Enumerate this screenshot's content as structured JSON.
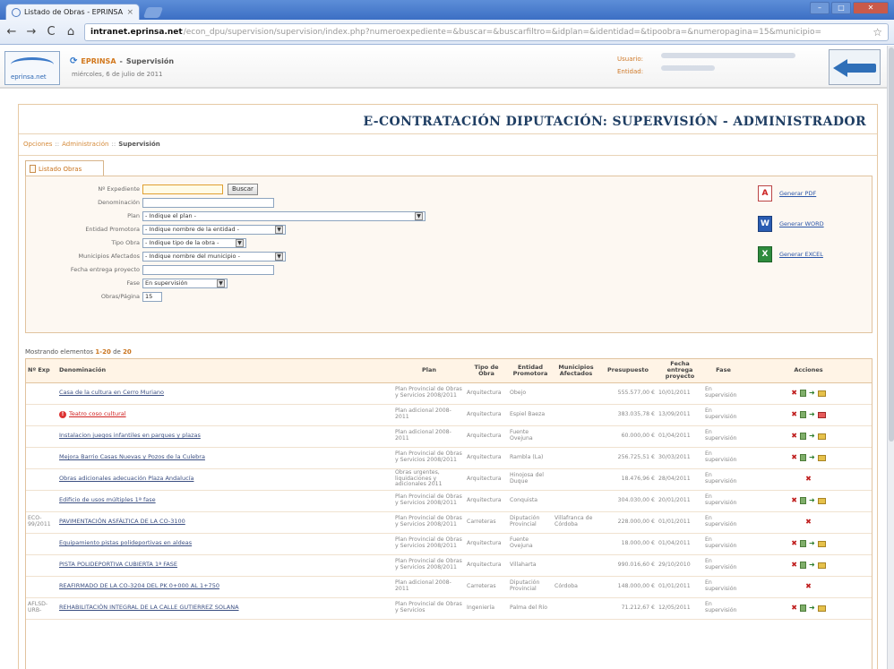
{
  "browser": {
    "tab_title": "Listado de Obras - EPRINSA",
    "tab_close": "×",
    "url_domain": "intranet.eprinsa.net",
    "url_path": "/econ_dpu/supervision/supervision/index.php?numeroexpediente=&buscar=&buscarfiltro=&idplan=&identidad=&tipoobra=&numeropagina=15&municipio=",
    "back": "←",
    "forward": "→",
    "reload": "C",
    "home": "⌂",
    "star": "☆",
    "win_min": "–",
    "win_max": "□",
    "win_close": "✕"
  },
  "header": {
    "org": "EPRINSA",
    "section": "Supervisión",
    "title_sep": "-",
    "date": "miércoles, 6 de julio de 2011",
    "user_label": "Usuario:",
    "entity_label": "Entidad:",
    "logo_text": "eprinsa.net"
  },
  "page_title": "E-CONTRATACIÓN DIPUTACIÓN: SUPERVISIÓN - ADMINISTRADOR",
  "breadcrumb": {
    "items": [
      "Opciones",
      "Administración",
      "Supervisión"
    ],
    "sep": "::"
  },
  "tab_label": "Listado Obras",
  "form": {
    "expediente_label": "Nº Expediente",
    "expediente_value": "",
    "search_button": "Buscar",
    "denominacion_label": "Denominación",
    "plan_label": "Plan",
    "plan_value": "- Indique el plan -",
    "entidad_label": "Entidad Promotora",
    "entidad_value": "- Indique nombre de la entidad -",
    "tipo_label": "Tipo Obra",
    "tipo_value": "- Indique tipo de la obra -",
    "municipio_label": "Municipios Afectados",
    "municipio_value": "- Indique nombre del municipio -",
    "fecha_label": "Fecha entrega proyecto",
    "fase_label": "Fase",
    "fase_value": "En supervisión",
    "obras_pagina_label": "Obras/Página",
    "obras_pagina_value": "15"
  },
  "exports": {
    "pdf": "Generar PDF",
    "word": "Generar WORD",
    "excel": "Generar EXCEL",
    "pdf_icon": "pdf-icon",
    "word_icon": "word-icon",
    "excel_icon": "excel-icon"
  },
  "showing": {
    "prefix": "Mostrando elementos",
    "range": "1-20",
    "de": "de",
    "total": "20"
  },
  "table": {
    "columns": [
      "Nº Exp",
      "Denominación",
      "Plan",
      "Tipo de Obra",
      "Entidad Promotora",
      "Municipios Afectados",
      "Presupuesto",
      "Fecha entrega proyecto",
      "Fase",
      "Acciones"
    ],
    "rows": [
      {
        "exp": "",
        "den": "Casa de la cultura en Cerro Muriano",
        "alert": false,
        "plan": "Plan Provincial de Obras y Servicios 2008/2011",
        "tipo": "Arquitectura",
        "entidad": "Obejo",
        "muni": "",
        "pres": "555.577,00 €",
        "fecha": "10/01/2011",
        "fase": "En supervisión",
        "actions": [
          "del",
          "doc",
          "arr",
          "fld"
        ]
      },
      {
        "exp": "",
        "den": "Teatro coso cultural",
        "alert": true,
        "plan": "Plan adicional 2008-2011",
        "tipo": "Arquitectura",
        "entidad": "Espiel Baeza",
        "muni": "",
        "pres": "383.035,78 €",
        "fecha": "13/09/2011",
        "fase": "En supervisión",
        "actions": [
          "del",
          "doc",
          "arr",
          "fldred"
        ]
      },
      {
        "exp": "",
        "den": "Instalacion juegos infantiles en parques y plazas",
        "alert": false,
        "plan": "Plan adicional 2008-2011",
        "tipo": "Arquitectura",
        "entidad": "Fuente Ovejuna",
        "muni": "",
        "pres": "60.000,00 €",
        "fecha": "01/04/2011",
        "fase": "En supervisión",
        "actions": [
          "del",
          "doc",
          "arr",
          "fld"
        ]
      },
      {
        "exp": "",
        "den": "Mejora Barrio Casas Nuevas y Pozos de la Culebra",
        "alert": false,
        "plan": "Plan Provincial de Obras y Servicios 2008/2011",
        "tipo": "Arquitectura",
        "entidad": "Rambla (La)",
        "muni": "",
        "pres": "256.725,51 €",
        "fecha": "30/03/2011",
        "fase": "En supervisión",
        "actions": [
          "del",
          "doc",
          "arr",
          "fld"
        ]
      },
      {
        "exp": "",
        "den": "Obras adicionales adecuación Plaza Andalucía",
        "alert": false,
        "plan": "Obras urgentes, liquidaciones y adicionales 2011",
        "tipo": "Arquitectura",
        "entidad": "Hinojosa del Duque",
        "muni": "",
        "pres": "18.476,96 €",
        "fecha": "28/04/2011",
        "fase": "En supervisión",
        "actions": [
          "del"
        ]
      },
      {
        "exp": "",
        "den": "Edificio de usos múltiples 1ª fase",
        "alert": false,
        "plan": "Plan Provincial de Obras y Servicios 2008/2011",
        "tipo": "Arquitectura",
        "entidad": "Conquista",
        "muni": "",
        "pres": "304.030,00 €",
        "fecha": "20/01/2011",
        "fase": "En supervisión",
        "actions": [
          "del",
          "doc",
          "arr",
          "fld"
        ]
      },
      {
        "exp": "ECO-99/2011",
        "den": "PAVIMENTACIÓN ASFÁLTICA DE LA CO-3100",
        "alert": false,
        "plan": "Plan Provincial de Obras y Servicios 2008/2011",
        "tipo": "Carreteras",
        "entidad": "Diputación Provincial",
        "muni": "Villafranca de Córdoba",
        "pres": "228.000,00 €",
        "fecha": "01/01/2011",
        "fase": "En supervisión",
        "actions": [
          "del"
        ]
      },
      {
        "exp": "",
        "den": "Equipamiento pistas polideportivas en aldeas",
        "alert": false,
        "plan": "Plan Provincial de Obras y Servicios 2008/2011",
        "tipo": "Arquitectura",
        "entidad": "Fuente Ovejuna",
        "muni": "",
        "pres": "18.000,00 €",
        "fecha": "01/04/2011",
        "fase": "En supervisión",
        "actions": [
          "del",
          "doc",
          "arr",
          "fld"
        ]
      },
      {
        "exp": "",
        "den": "PISTA POLIDEPORTIVA CUBIERTA 1ª FASE",
        "alert": false,
        "plan": "Plan Provincial de Obras y Servicios 2008/2011",
        "tipo": "Arquitectura",
        "entidad": "Villaharta",
        "muni": "",
        "pres": "990.016,60 €",
        "fecha": "29/10/2010",
        "fase": "En supervisión",
        "actions": [
          "del",
          "doc",
          "arr",
          "fld"
        ]
      },
      {
        "exp": "",
        "den": "REAFIRMADO DE LA CO-3204 DEL PK 0+000 AL 1+750",
        "alert": false,
        "plan": "Plan adicional 2008-2011",
        "tipo": "Carreteras",
        "entidad": "Diputación Provincial",
        "muni": "Córdoba",
        "pres": "148.000,00 €",
        "fecha": "01/01/2011",
        "fase": "En supervisión",
        "actions": [
          "del"
        ]
      },
      {
        "exp": "AFLSD-URB-",
        "den": "REHABILITACIÓN INTEGRAL DE LA CALLE GUTIERREZ SOLANA",
        "alert": false,
        "plan": "Plan Provincial de Obras y Servicios",
        "tipo": "Ingeniería",
        "entidad": "Palma del Río",
        "muni": "",
        "pres": "71.212,67 €",
        "fecha": "12/05/2011",
        "fase": "En supervisión",
        "actions": [
          "del",
          "doc",
          "arr",
          "fld"
        ]
      }
    ]
  }
}
